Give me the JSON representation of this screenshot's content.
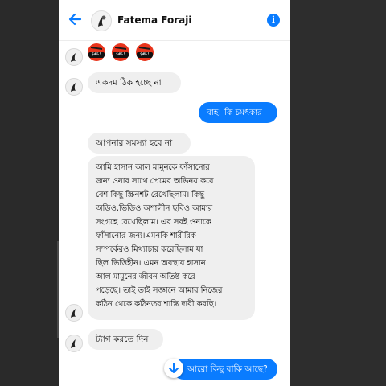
{
  "header": {
    "contact_name": "Fatema Foraji",
    "back_icon": "back-arrow-icon",
    "info_icon": "info-icon"
  },
  "colors": {
    "accent": "#0a7cff",
    "incoming_bubble": "#efefef",
    "emoji_red": "#e8341c"
  },
  "messages": [
    {
      "direction": "in",
      "type": "emoji",
      "emojis": [
        "face-with-symbols-on-mouth",
        "face-with-symbols-on-mouth",
        "face-with-symbols-on-mouth"
      ],
      "emoji_text": "$#&!",
      "text": ""
    },
    {
      "direction": "in",
      "type": "text",
      "text": "একদম ঠিক হচ্ছে না"
    },
    {
      "direction": "out",
      "type": "text",
      "text": "বাহ! কি চমৎকার"
    },
    {
      "direction": "in",
      "type": "text",
      "text": "আপনার সমস্যা হবে না"
    },
    {
      "direction": "in",
      "type": "text",
      "text": "আমি হাসান আল মামুনকে ফাঁসানোর\nজন্য ওনার সাথে প্রেমের অভিনয় করে\nবেশ কিছু স্ক্রিনশট রেখেছিলাম। কিছু\nঅডিও,ভিডিও অশালীন ছবিও আমার\nসংগ্রহে রেখেছিলাম। এর সবই ওনাকে\nফাঁসানোর জন্য।এমনকি শারীরিক\nসম্পর্কেরও মিথ্যাচার করেছিলাম যা\nছিল ভিত্তিহীন। এমন অবস্থায়  হাসান\nআল মামুনের জীবন অতিষ্ট করে\nপড়েছে। তাই তাই সজ্ঞানে আমার নিজের\nকঠিন থেকে কঠিনতর শাস্তি দাবী করছি।"
    },
    {
      "direction": "in",
      "type": "text",
      "text": "ট্যাগ করতে দিন"
    },
    {
      "direction": "out",
      "type": "text",
      "text": "আরো কিছু বাকি আছে?"
    }
  ],
  "scroll_down_icon": "arrow-down-icon"
}
